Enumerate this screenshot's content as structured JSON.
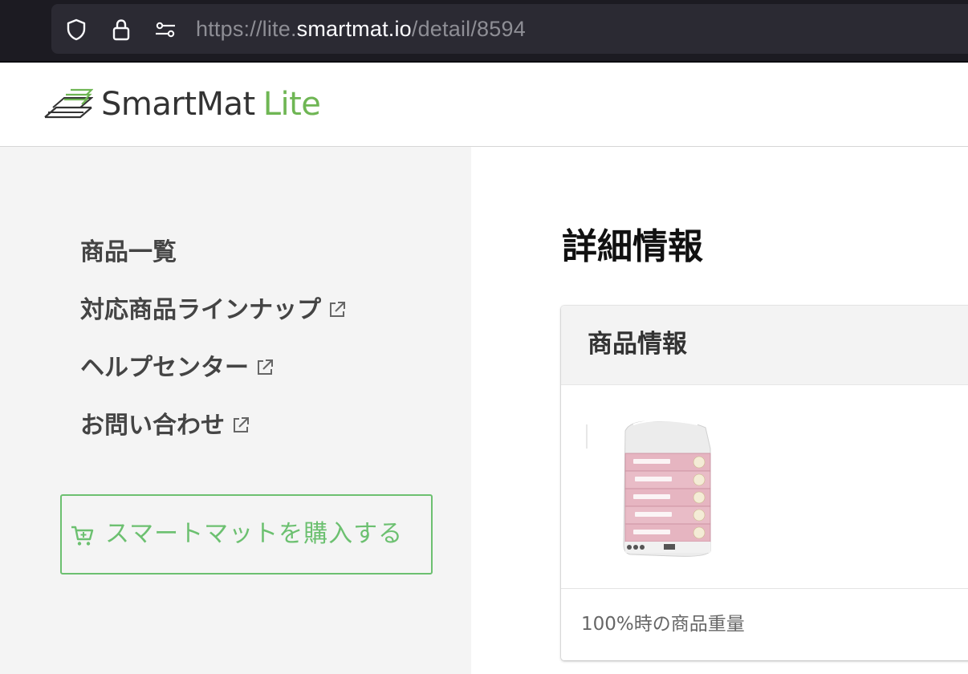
{
  "browser": {
    "url_prefix": "https://lite.",
    "url_host": "smartmat.io",
    "url_path": "/detail/8594",
    "icons": [
      "shield-icon",
      "lock-icon",
      "site-permissions-icon"
    ]
  },
  "header": {
    "logo_name": "SmartMat",
    "logo_suffix": "Lite"
  },
  "sidebar": {
    "items": [
      {
        "label": "商品一覧",
        "external": false
      },
      {
        "label": "対応商品ラインナップ",
        "external": true
      },
      {
        "label": "ヘルプセンター",
        "external": true
      },
      {
        "label": "お問い合わせ",
        "external": true
      }
    ],
    "buy_button_label": "スマートマットを購入する"
  },
  "main": {
    "page_title": "詳細情報",
    "card": {
      "title": "商品情報",
      "image_icon": "hand-towel-pack-image",
      "weight_label": "100%時の商品重量"
    }
  },
  "colors": {
    "brand_green": "#6fb654",
    "button_green": "#6cc070",
    "sidebar_bg": "#f4f4f4",
    "chrome_bg": "#1c1b22"
  }
}
